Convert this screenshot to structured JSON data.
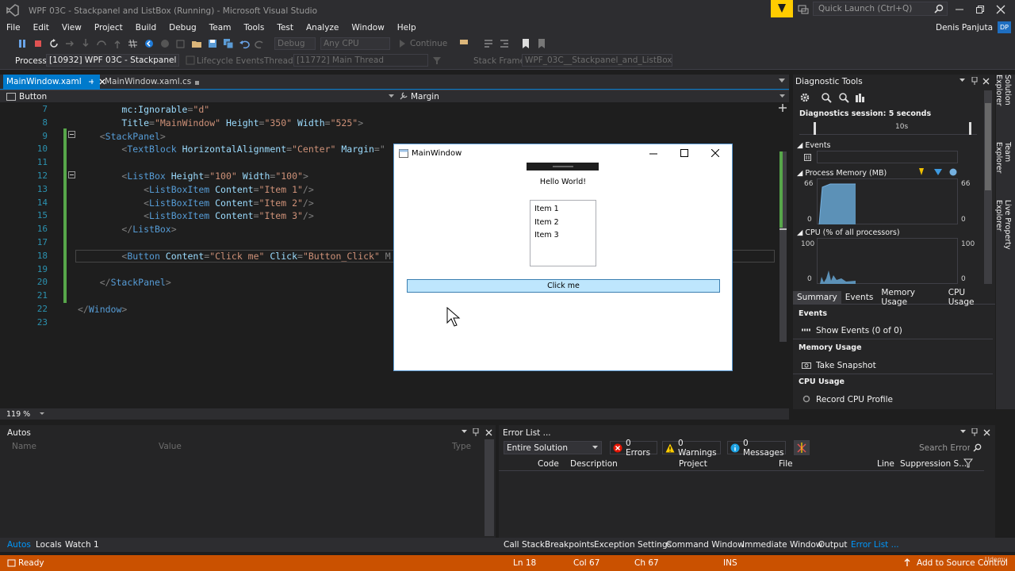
{
  "window": {
    "title": "WPF 03C - Stackpanel and ListBox (Running) - Microsoft Visual Studio",
    "quick_launch": "Quick Launch (Ctrl+Q)",
    "user": "Denis Panjuta",
    "user_initials": "DP"
  },
  "menu": [
    "File",
    "Edit",
    "View",
    "Project",
    "Build",
    "Debug",
    "Team",
    "Tools",
    "Test",
    "Analyze",
    "Window",
    "Help"
  ],
  "toolbar": {
    "config": "Debug",
    "platform": "Any CPU",
    "continue": "Continue"
  },
  "toolbar2": {
    "process_label": "Process:",
    "process": "[10932] WPF 03C - Stackpanel anc",
    "lifecycle": "Lifecycle Events",
    "thread_label": "Thread:",
    "thread": "[11772] Main Thread",
    "stackframe_label": "Stack Frame:",
    "stackframe": "WPF_03C__Stackpanel_and_ListBox.Main"
  },
  "tabs": [
    {
      "label": "MainWindow.xaml",
      "active": true
    },
    {
      "label": "MainWindow.xaml.cs",
      "active": false
    }
  ],
  "nav": {
    "left": "Button",
    "right": "Margin"
  },
  "code_lines": [
    {
      "n": "7",
      "indent": "        ",
      "parts": [
        [
          "attr",
          "mc:Ignorable"
        ],
        [
          "br",
          "="
        ],
        [
          "val",
          "\"d\""
        ]
      ]
    },
    {
      "n": "8",
      "indent": "        ",
      "parts": [
        [
          "attr",
          "Title"
        ],
        [
          "br",
          "="
        ],
        [
          "val",
          "\"MainWindow\""
        ],
        [
          "attr",
          " Height"
        ],
        [
          "br",
          "="
        ],
        [
          "val",
          "\"350\""
        ],
        [
          "attr",
          " Width"
        ],
        [
          "br",
          "="
        ],
        [
          "val",
          "\"525\""
        ],
        [
          "br",
          ">"
        ]
      ]
    },
    {
      "n": "9",
      "indent": "    ",
      "parts": [
        [
          "br",
          "<"
        ],
        [
          "tag",
          "StackPanel"
        ],
        [
          "br",
          ">"
        ]
      ]
    },
    {
      "n": "10",
      "indent": "        ",
      "parts": [
        [
          "br",
          "<"
        ],
        [
          "tag",
          "TextBlock"
        ],
        [
          "attr",
          " HorizontalAlignment"
        ],
        [
          "br",
          "="
        ],
        [
          "val",
          "\"Center\""
        ],
        [
          "attr",
          " Margin"
        ],
        [
          "br",
          "=\""
        ]
      ]
    },
    {
      "n": "11",
      "indent": "",
      "parts": []
    },
    {
      "n": "12",
      "indent": "        ",
      "parts": [
        [
          "br",
          "<"
        ],
        [
          "tag",
          "ListBox"
        ],
        [
          "attr",
          " Height"
        ],
        [
          "br",
          "="
        ],
        [
          "val",
          "\"100\""
        ],
        [
          "attr",
          " Width"
        ],
        [
          "br",
          "="
        ],
        [
          "val",
          "\"100\""
        ],
        [
          "br",
          ">"
        ]
      ]
    },
    {
      "n": "13",
      "indent": "            ",
      "parts": [
        [
          "br",
          "<"
        ],
        [
          "tag",
          "ListBoxItem"
        ],
        [
          "attr",
          " Content"
        ],
        [
          "br",
          "="
        ],
        [
          "val",
          "\"Item 1\""
        ],
        [
          "br",
          "/>"
        ]
      ]
    },
    {
      "n": "14",
      "indent": "            ",
      "parts": [
        [
          "br",
          "<"
        ],
        [
          "tag",
          "ListBoxItem"
        ],
        [
          "attr",
          " Content"
        ],
        [
          "br",
          "="
        ],
        [
          "val",
          "\"Item 2\""
        ],
        [
          "br",
          "/>"
        ]
      ]
    },
    {
      "n": "15",
      "indent": "            ",
      "parts": [
        [
          "br",
          "<"
        ],
        [
          "tag",
          "ListBoxItem"
        ],
        [
          "attr",
          " Content"
        ],
        [
          "br",
          "="
        ],
        [
          "val",
          "\"Item 3\""
        ],
        [
          "br",
          "/>"
        ]
      ]
    },
    {
      "n": "16",
      "indent": "        ",
      "parts": [
        [
          "br",
          "</"
        ],
        [
          "tag",
          "ListBox"
        ],
        [
          "br",
          ">"
        ]
      ]
    },
    {
      "n": "17",
      "indent": "",
      "parts": []
    },
    {
      "n": "18",
      "indent": "        ",
      "parts": [
        [
          "br",
          "<"
        ],
        [
          "tag",
          "Button"
        ],
        [
          "attr",
          " Content"
        ],
        [
          "br",
          "="
        ],
        [
          "val",
          "\"Click me\""
        ],
        [
          "attr",
          " Click"
        ],
        [
          "br",
          "="
        ],
        [
          "val",
          "\"Button_Click\""
        ],
        [
          "br",
          " M"
        ]
      ]
    },
    {
      "n": "19",
      "indent": "",
      "parts": []
    },
    {
      "n": "20",
      "indent": "    ",
      "parts": [
        [
          "br",
          "</"
        ],
        [
          "tag",
          "StackPanel"
        ],
        [
          "br",
          ">"
        ]
      ]
    },
    {
      "n": "21",
      "indent": "",
      "parts": []
    },
    {
      "n": "22",
      "indent": "",
      "parts": [
        [
          "br",
          "</"
        ],
        [
          "tag",
          "Window"
        ],
        [
          "br",
          ">"
        ]
      ]
    },
    {
      "n": "23",
      "indent": "",
      "parts": []
    }
  ],
  "zoom": "119 %",
  "wpf": {
    "title": "MainWindow",
    "text": "Hello World!",
    "items": [
      "Item 1",
      "Item 2",
      "Item 3"
    ],
    "button": "Click me"
  },
  "diag": {
    "title": "Diagnostic Tools",
    "session": "Diagnostics session: 5 seconds",
    "tick": "10s",
    "events": "Events",
    "memory": "Process Memory (MB)",
    "mem_max": "66",
    "mem_min": "0",
    "cpu": "CPU (% of all processors)",
    "cpu_max": "100",
    "cpu_min": "0",
    "tabs": [
      "Summary",
      "Events",
      "Memory Usage",
      "CPU Usage"
    ],
    "sections": [
      {
        "head": "Events",
        "action": "Show Events (0 of 0)"
      },
      {
        "head": "Memory Usage",
        "action": "Take Snapshot"
      },
      {
        "head": "CPU Usage",
        "action": "Record CPU Profile"
      }
    ]
  },
  "rightrail": [
    "Solution Explorer",
    "Team Explorer",
    "Live Property Explorer"
  ],
  "autos": {
    "title": "Autos",
    "cols": [
      "Name",
      "Value",
      "Type"
    ]
  },
  "errors": {
    "title": "Error List ...",
    "scope": "Entire Solution",
    "errors": "0 Errors",
    "warnings": "0 Warnings",
    "messages": "0 Messages",
    "search": "Search Error L",
    "cols": [
      "Code",
      "Description",
      "Project",
      "File",
      "Line",
      "Suppression S..."
    ]
  },
  "bottom_left": [
    "Autos",
    "Locals",
    "Watch 1"
  ],
  "bottom_right": [
    "Call Stack",
    "Breakpoints",
    "Exception Settings",
    "Command Window",
    "Immediate Window",
    "Output",
    "Error List ..."
  ],
  "status": {
    "ready": "Ready",
    "ln": "Ln 18",
    "col": "Col 67",
    "ch": "Ch 67",
    "mode": "INS",
    "source": "Add to Source Control"
  },
  "watermark": "Udemy"
}
